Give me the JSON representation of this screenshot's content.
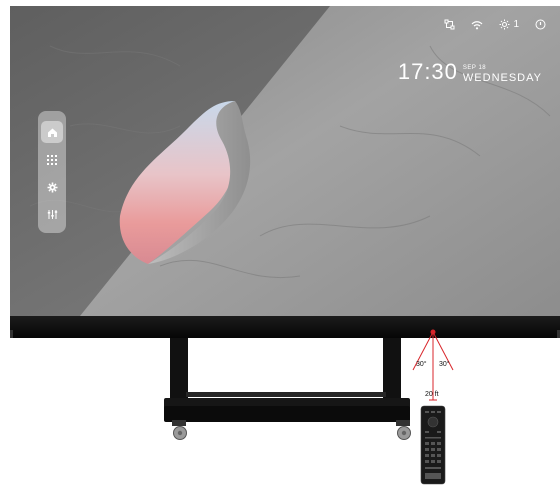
{
  "status_bar": {
    "icons": [
      "network-icon",
      "wifi-icon",
      "brightness-icon",
      "power-icon"
    ],
    "brightness_value": "1"
  },
  "clock": {
    "time": "17:30",
    "date": "SEP 18",
    "day": "WEDNESDAY"
  },
  "dock": {
    "items": [
      {
        "icon": "home-icon",
        "active": true
      },
      {
        "icon": "apps-grid-icon",
        "active": false
      },
      {
        "icon": "settings-gear-icon",
        "active": false
      },
      {
        "icon": "equalizer-icon",
        "active": false
      }
    ]
  },
  "remote_diagram": {
    "left_angle": "30°",
    "right_angle": "30°",
    "distance": "20 ft"
  },
  "colors": {
    "accent": "#d9262b",
    "bezel": "#0e0e0e",
    "wallpaper": "#9a9a9a"
  }
}
